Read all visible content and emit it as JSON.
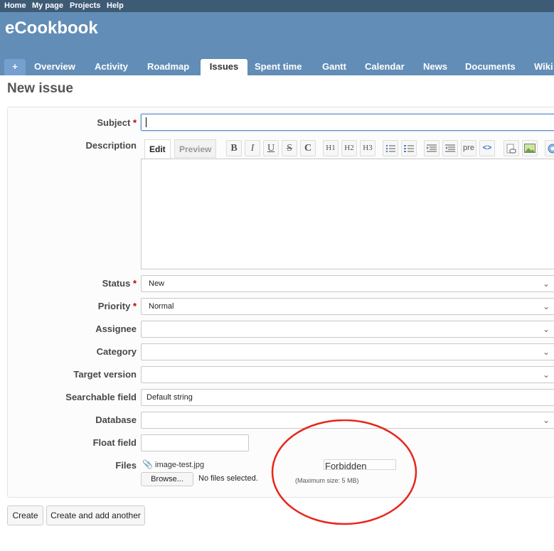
{
  "top_menu": {
    "home": "Home",
    "my_page": "My page",
    "projects": "Projects",
    "help": "Help"
  },
  "app_title": "eCookbook",
  "tabs": {
    "new": "+",
    "overview": "Overview",
    "activity": "Activity",
    "roadmap": "Roadmap",
    "issues": "Issues",
    "spent_time": "Spent time",
    "gantt": "Gantt",
    "calendar": "Calendar",
    "news": "News",
    "documents": "Documents",
    "wiki": "Wiki"
  },
  "page_title": "New issue",
  "form": {
    "subject_label": "Subject",
    "description_label": "Description",
    "editor_tabs": {
      "edit": "Edit",
      "preview": "Preview"
    },
    "toolbar": {
      "bold": "B",
      "italic": "I",
      "underline": "U",
      "strike": "S",
      "code_inline": "C",
      "h1": "H1",
      "h2": "H2",
      "h3": "H3",
      "pre": "pre",
      "code_block": "<>"
    },
    "status_label": "Status",
    "status_value": "New",
    "priority_label": "Priority",
    "priority_value": "Normal",
    "assignee_label": "Assignee",
    "category_label": "Category",
    "target_version_label": "Target version",
    "searchable_field_label": "Searchable field",
    "searchable_field_value": "Default string",
    "database_label": "Database",
    "float_field_label": "Float field",
    "files_label": "Files",
    "attached_file": "image-test.jpg",
    "browse_label": "Browse...",
    "no_files": "No files selected.",
    "forbidden": "Forbidden",
    "max_size": "(Maximum size: 5 MB)",
    "required_mark": "*"
  },
  "buttons": {
    "create": "Create",
    "create_another": "Create and add another"
  },
  "colors": {
    "header": "#628db6",
    "top_menu": "#3e5b76",
    "required": "#bb0000",
    "annotation": "#e8261c"
  }
}
